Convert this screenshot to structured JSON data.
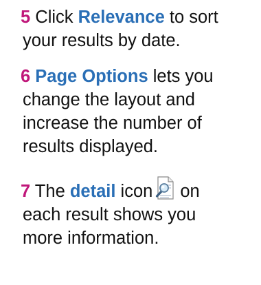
{
  "steps": [
    {
      "number": "5",
      "before": " Click ",
      "keyword": "Relevance",
      "after": " to sort",
      "line2": "your results by date."
    },
    {
      "number": "6",
      "keyword": "Page Options",
      "after": " lets you",
      "line2": "change the layout and",
      "line3": "increase the number of",
      "line4": "results displayed."
    },
    {
      "number": "7",
      "before": " The ",
      "keyword": "detail",
      "after": " icon",
      "after_icon": "on",
      "icon": "detail-magnifier-document-icon",
      "line2": "each result shows you",
      "line3": "more information."
    }
  ],
  "colors": {
    "number": "#c0177a",
    "keyword": "#2a6fb6",
    "text": "#111111"
  }
}
